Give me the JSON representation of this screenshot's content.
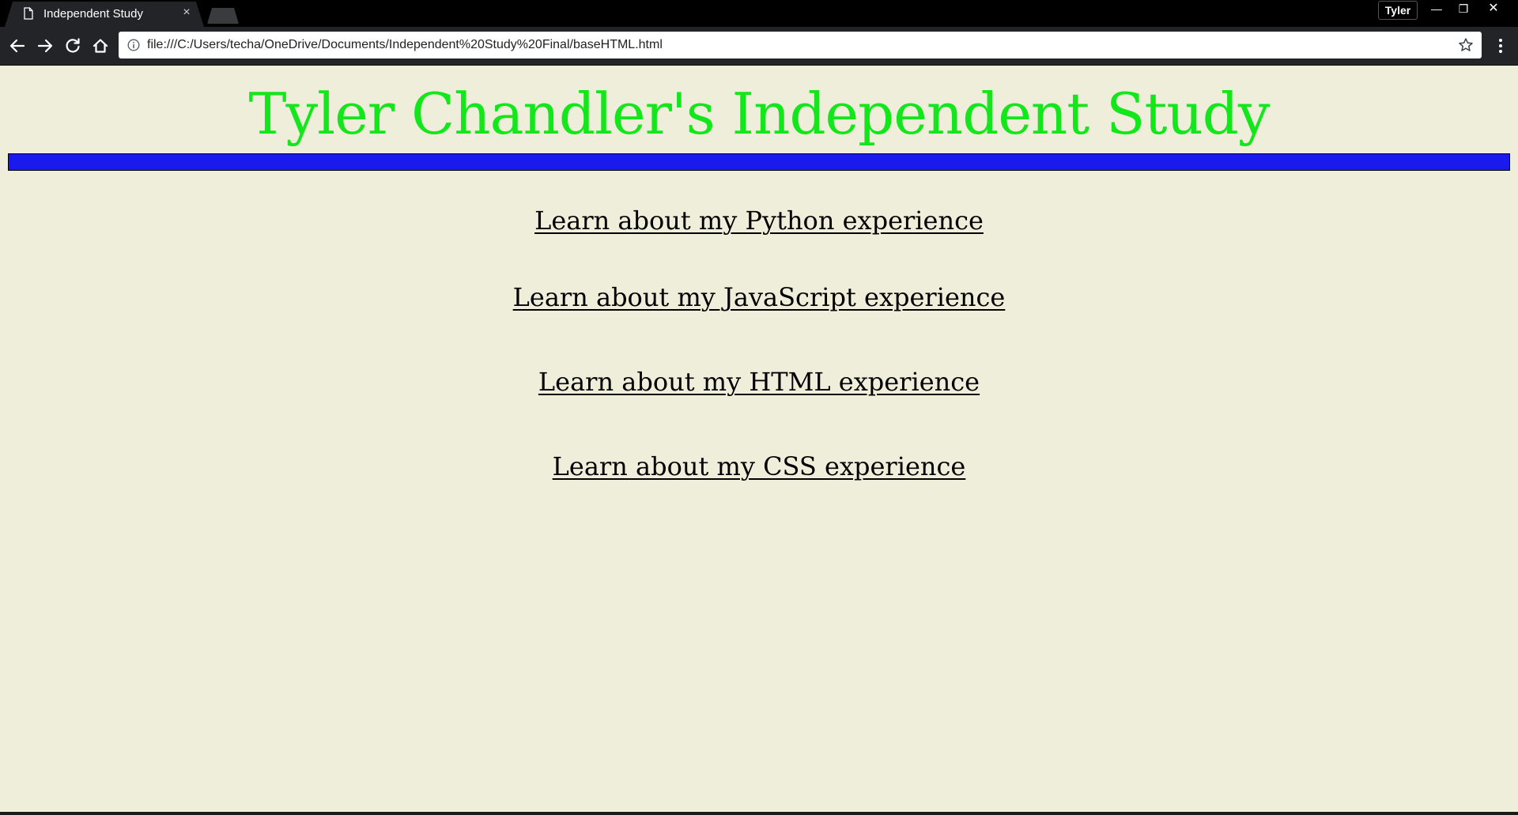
{
  "browser": {
    "tab": {
      "title": "Independent Study",
      "close_symbol": "×"
    },
    "profile_name": "Tyler",
    "window_buttons": {
      "minimize": "—",
      "maximize": "❐",
      "close": "✕"
    },
    "url": "file:///C:/Users/techa/OneDrive/Documents/Independent%20Study%20Final/baseHTML.html"
  },
  "page": {
    "title": "Tyler Chandler's Independent Study",
    "links": [
      "Learn about my Python experience",
      "Learn about my JavaScript experience",
      "Learn about my HTML experience",
      "Learn about my CSS experience"
    ]
  },
  "colors": {
    "background": "#EFEEDA",
    "title": "#14E61C",
    "bar": "#1A1AEE",
    "chrome": "#000000",
    "toolbar": "#232427"
  },
  "icons": {
    "tab": "document-icon",
    "back": "arrow-left-icon",
    "forward": "arrow-right-icon",
    "reload": "reload-icon",
    "home": "home-icon",
    "info": "info-icon",
    "bookmark": "star-icon",
    "menu": "kebab-menu-icon"
  }
}
